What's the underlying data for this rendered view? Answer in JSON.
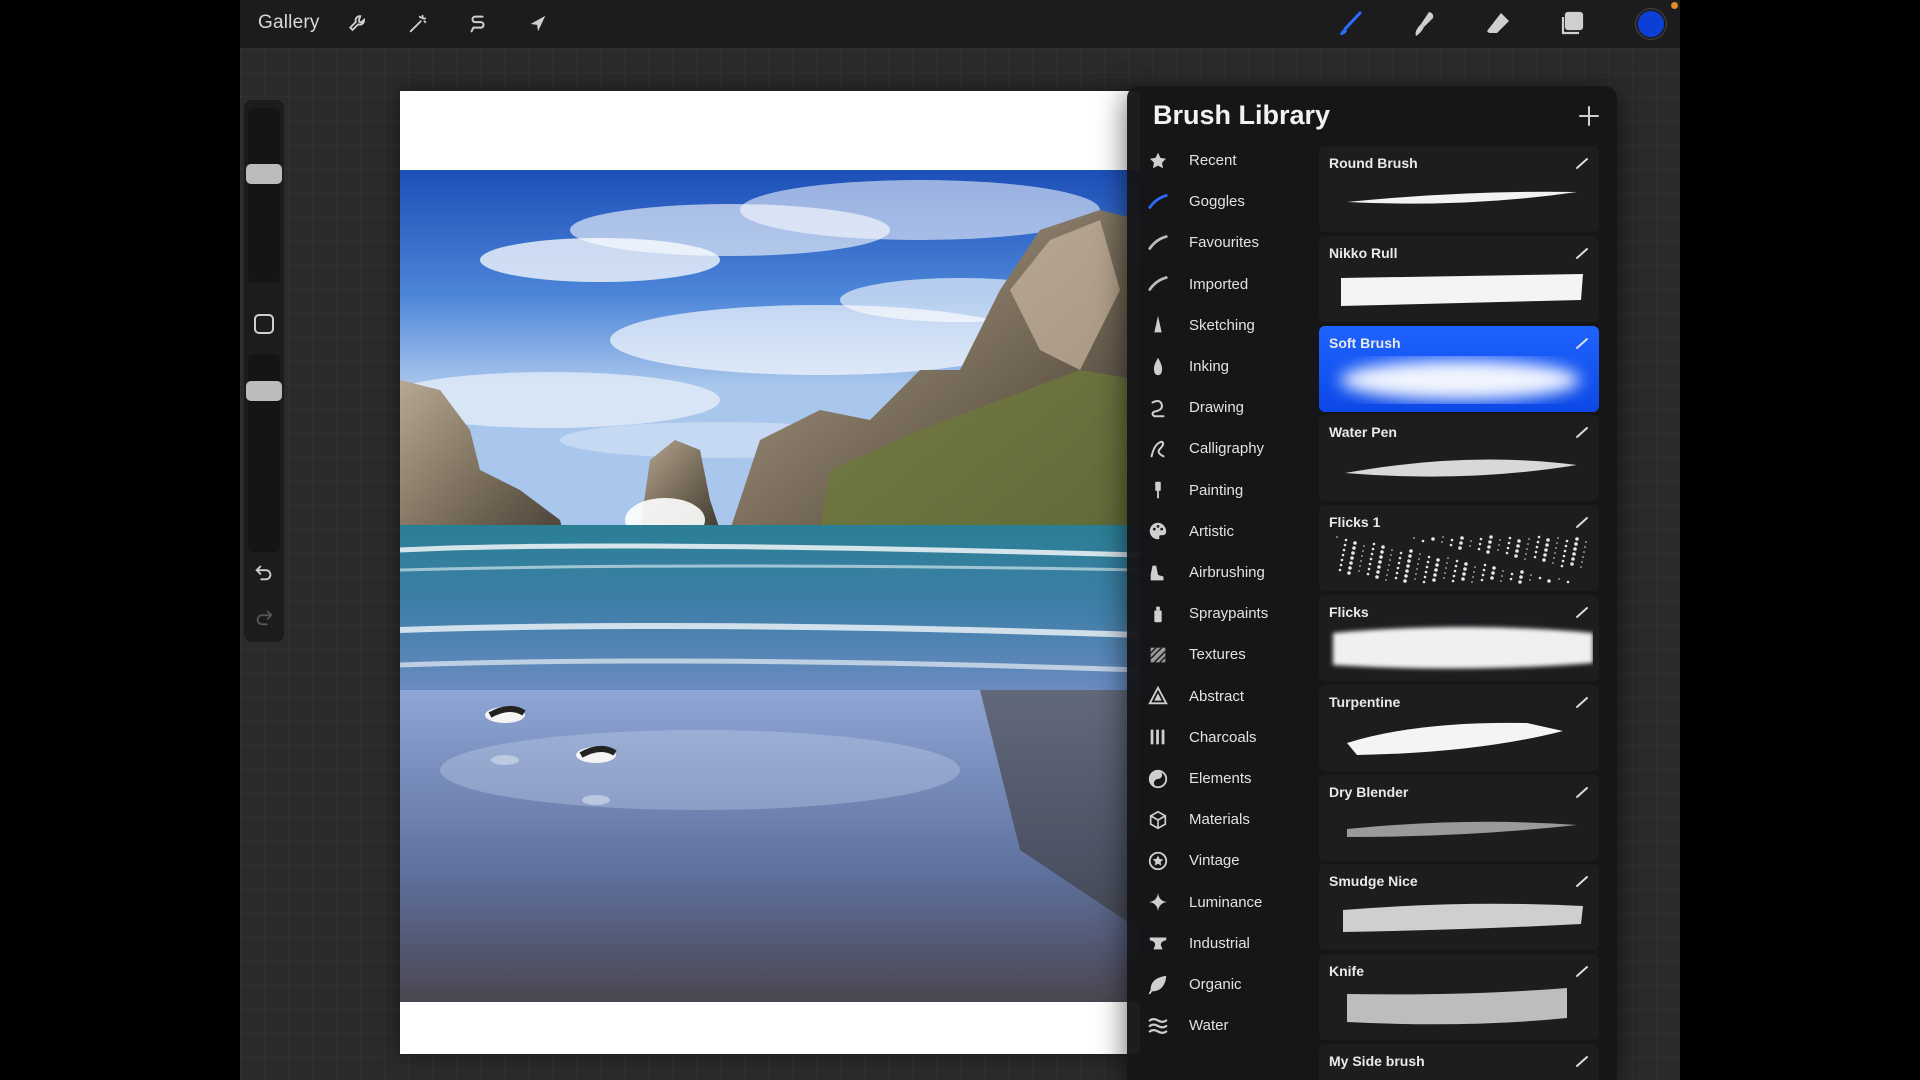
{
  "topbar": {
    "gallery_label": "Gallery",
    "left_tools": [
      "wrench-icon",
      "magic-wand-icon",
      "selection-s-icon",
      "transform-arrow-icon"
    ],
    "right_tools": [
      "brush-icon",
      "smudge-icon",
      "eraser-icon",
      "layers-icon"
    ],
    "color": "#0b3fd6"
  },
  "sidebar": {
    "brush_size": 0.36,
    "opacity": 0.15,
    "controls": [
      "modify-button",
      "undo-icon",
      "redo-icon"
    ]
  },
  "library": {
    "title": "Brush Library",
    "add_icon": "plus-icon",
    "sets": [
      {
        "label": "Recent",
        "icon": "star-icon"
      },
      {
        "label": "Goggles",
        "icon": "blue-stroke-icon"
      },
      {
        "label": "Favourites",
        "icon": "stroke-icon"
      },
      {
        "label": "Imported",
        "icon": "stroke-icon"
      },
      {
        "label": "Sketching",
        "icon": "pencil-tip-icon"
      },
      {
        "label": "Inking",
        "icon": "ink-drop-icon"
      },
      {
        "label": "Drawing",
        "icon": "swirl-icon"
      },
      {
        "label": "Calligraphy",
        "icon": "calligraphy-a-icon"
      },
      {
        "label": "Painting",
        "icon": "paint-brush-icon"
      },
      {
        "label": "Artistic",
        "icon": "palette-icon"
      },
      {
        "label": "Airbrushing",
        "icon": "airbrush-icon"
      },
      {
        "label": "Spraypaints",
        "icon": "spray-can-icon"
      },
      {
        "label": "Textures",
        "icon": "texture-icon"
      },
      {
        "label": "Abstract",
        "icon": "triangle-icon"
      },
      {
        "label": "Charcoals",
        "icon": "charcoal-bars-icon"
      },
      {
        "label": "Elements",
        "icon": "yin-yang-icon"
      },
      {
        "label": "Materials",
        "icon": "cube-icon"
      },
      {
        "label": "Vintage",
        "icon": "vintage-star-icon"
      },
      {
        "label": "Luminance",
        "icon": "sparkle-icon"
      },
      {
        "label": "Industrial",
        "icon": "anvil-icon"
      },
      {
        "label": "Organic",
        "icon": "leaf-icon"
      },
      {
        "label": "Water",
        "icon": "waves-icon"
      }
    ],
    "brushes": [
      {
        "name": "Round Brush",
        "selected": false
      },
      {
        "name": "Nikko Rull",
        "selected": false
      },
      {
        "name": "Soft Brush",
        "selected": true
      },
      {
        "name": "Water Pen",
        "selected": false
      },
      {
        "name": "Flicks 1",
        "selected": false
      },
      {
        "name": "Flicks",
        "selected": false
      },
      {
        "name": "Turpentine",
        "selected": false
      },
      {
        "name": "Dry Blender",
        "selected": false
      },
      {
        "name": "Smudge Nice",
        "selected": false
      },
      {
        "name": "Knife",
        "selected": false
      },
      {
        "name": "My Side brush",
        "selected": false
      }
    ]
  }
}
